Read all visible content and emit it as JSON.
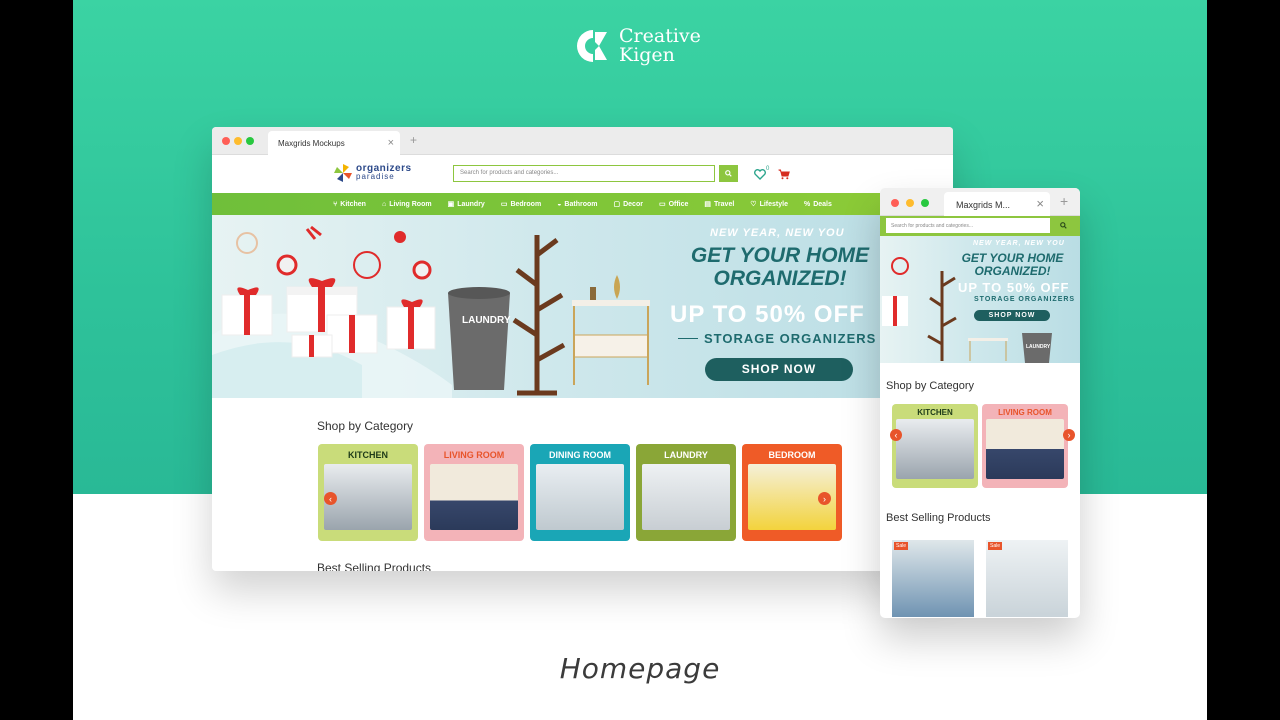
{
  "brand": {
    "line1": "Creative",
    "line2": "Kigen"
  },
  "caption": "Homepage",
  "colors": {
    "teal": "#33c89e",
    "green": "#8dc63f",
    "hero_dark": "#1e6b6e"
  },
  "desktop": {
    "tab_title": "Maxgrids Mockups",
    "logo_line1": "organizers",
    "logo_line2": "paradise",
    "search_placeholder": "Search for products and categories...",
    "wishlist_count": "0",
    "nav": [
      {
        "label": "Kitchen",
        "icon": "fork-icon"
      },
      {
        "label": "Living Room",
        "icon": "sofa-icon"
      },
      {
        "label": "Laundry",
        "icon": "basket-icon"
      },
      {
        "label": "Bedroom",
        "icon": "bed-icon"
      },
      {
        "label": "Bathroom",
        "icon": "bath-icon"
      },
      {
        "label": "Decor",
        "icon": "frame-icon"
      },
      {
        "label": "Office",
        "icon": "monitor-icon"
      },
      {
        "label": "Travel",
        "icon": "suitcase-icon"
      },
      {
        "label": "Lifestyle",
        "icon": "heart-icon"
      },
      {
        "label": "Deals",
        "icon": "percent-icon"
      }
    ],
    "hero": {
      "line1": "NEW YEAR, NEW YOU",
      "line2a": "GET YOUR HOME",
      "line2b": "ORGANIZED!",
      "line3": "UP TO 50% OFF",
      "line4": "STORAGE ORGANIZERS",
      "button": "SHOP NOW",
      "basket_label": "LAUNDRY"
    },
    "shop_by_category": "Shop by Category",
    "categories": [
      {
        "label": "KITCHEN"
      },
      {
        "label": "LIVING ROOM"
      },
      {
        "label": "DINING ROOM"
      },
      {
        "label": "LAUNDRY"
      },
      {
        "label": "BEDROOM"
      }
    ],
    "best_selling": "Best Selling Products"
  },
  "mobile": {
    "tab_title": "Maxgrids M...",
    "search_placeholder": "Search for products and categories...",
    "hero": {
      "line1": "NEW YEAR, NEW YOU",
      "line2a": "GET YOUR HOME",
      "line2b": "ORGANIZED!",
      "line3": "UP TO 50% OFF",
      "line4": "STORAGE ORGANIZERS",
      "button": "SHOP NOW",
      "basket_label": "LAUNDRY"
    },
    "shop_by_category": "Shop by Category",
    "categories": [
      {
        "label": "KITCHEN"
      },
      {
        "label": "LIVING ROOM"
      }
    ],
    "best_selling": "Best Selling Products",
    "badge": "Sale"
  }
}
